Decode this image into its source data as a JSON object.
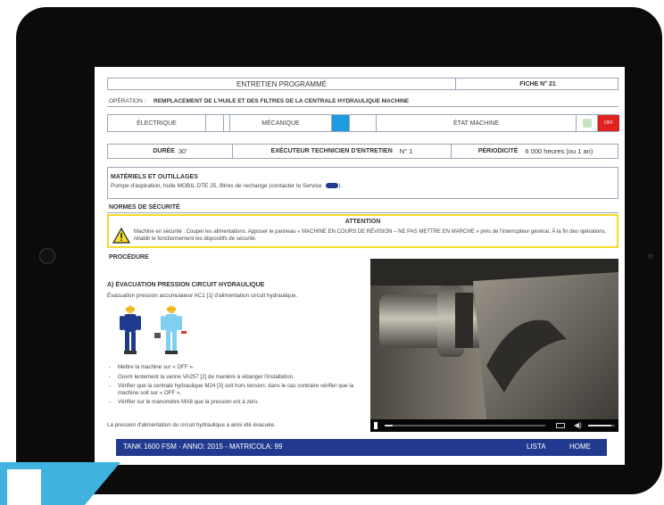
{
  "form": {
    "title": "ENTRETIEN PROGRAMMÉ",
    "fiche": "FICHE N° 21",
    "operation_label": "OPÉRATION :",
    "operation_value": "REMPLACEMENT DE L'HUILE ET DES FILTRES DE LA CENTRALE HYDRAULIQUE MACHINE",
    "type_electrique": "ÉLECTRIQUE",
    "type_mecanique": "MÉCANIQUE",
    "etat_machine": "ÉTAT MACHINE",
    "off_label": "OFF",
    "duree_label": "DURÉE",
    "duree_value": "30'",
    "executeur_label": "EXÉCUTEUR TECHNICIEN D'ENTRETIEN",
    "executeur_value": "N° 1",
    "periodicite_label": "PÉRIODICITÉ",
    "periodicite_value": "6 000 heures (ou 1 an)",
    "materiels_title": "MATÉRIELS ET OUTILLAGES",
    "materiels_text": "Pompe d'aspiration, huile MOBIL DTE 25, filtres de rechange (contacter le Service",
    "normes_title": "NORMES DE SÉCURITÉ"
  },
  "attention": {
    "title": "ATTENTION",
    "text": "Machine en sécurité : Couper les alimentations. Apposer le panneau « MACHINE EN COURS DE RÉVISION – NE PAS METTRE EN MARCHE » près de l'interrupteur général. À la fin des opérations, rétablir le fonctionnement les dispositifs de sécurité."
  },
  "procedure": {
    "title": "PROCÉDURE",
    "section_a": "A) ÉVACUATION PRESSION CIRCUIT HYDRAULIQUE",
    "section_a_text": "Évacuation pression accumulateur AC1 [1] d'alimentation circuit hydraulique.",
    "steps": [
      "Mettre la machine sur « OFF ».",
      "Ouvrir lentement la vanne VA257 [2] de manière à vidanger l'installation.",
      "Vérifier que la centrale hydraulique M24 [3] soit hors tension; dans le cas contraire vérifier que la machine soit sur « OFF ».",
      "Vérifier sur le manomètre MA8 que la pression est à zéro."
    ],
    "conclusion": "La pression d'alimentation du circuit hydraulique a ainsi été évacuée."
  },
  "video": {
    "progress": 0.05,
    "volume": 0.85
  },
  "footer": {
    "tank": "TANK 1600 FSM - ANNO: 2015 - MATRICOLA: 99",
    "lista": "LISTA",
    "home": "HOME"
  },
  "colors": {
    "footer_bg": "#213a8f",
    "mechanical_indicator": "#1e9be0",
    "off_indicator": "#e0231f",
    "on_indicator": "#c9e4c2",
    "warning_border": "#f2dd2a",
    "logo_accent": "#3fb3dd"
  }
}
